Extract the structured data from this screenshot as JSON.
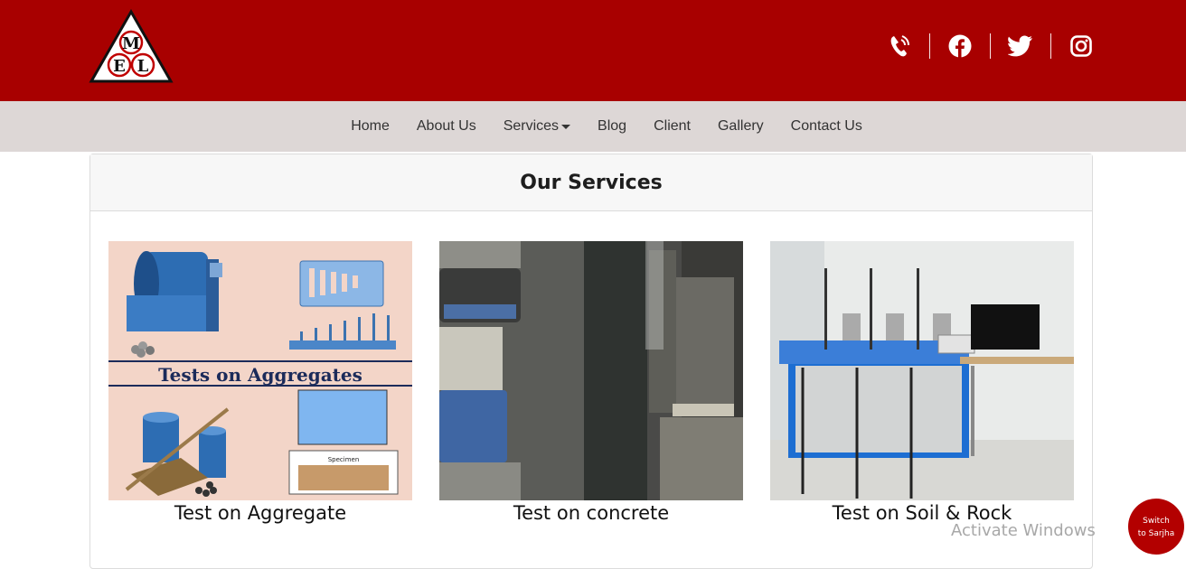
{
  "brand": {
    "logo_letters": [
      "M",
      "E",
      "L"
    ],
    "colors": {
      "topbar": "#a80000",
      "navbar": "#ddd7d6",
      "accent": "#b30000"
    }
  },
  "social": [
    {
      "name": "phone-icon"
    },
    {
      "name": "facebook-icon"
    },
    {
      "name": "twitter-icon"
    },
    {
      "name": "instagram-icon"
    }
  ],
  "nav": {
    "items": [
      "Home",
      "About Us",
      "Services",
      "Blog",
      "Client",
      "Gallery",
      "Contact Us"
    ]
  },
  "services": {
    "title": "Our Services",
    "cards": [
      {
        "caption": "Test on Aggregate",
        "banner": "Tests on Aggregates",
        "label": "Specimen"
      },
      {
        "caption": "Test on concrete"
      },
      {
        "caption": "Test on Soil & Rock"
      }
    ]
  },
  "overlay": {
    "watermark": "Activate Windows",
    "switch_label_1": "Switch",
    "switch_label_2": "to Sarjha"
  }
}
